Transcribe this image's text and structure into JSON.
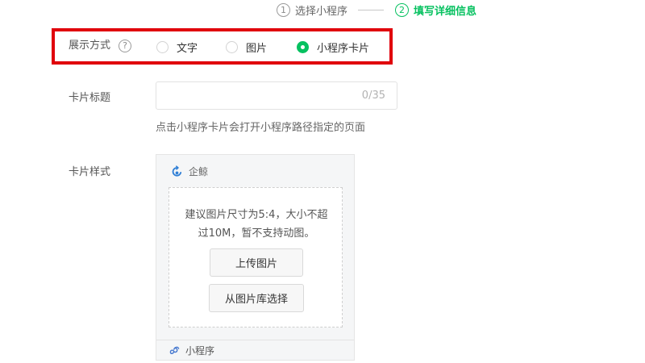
{
  "steps": [
    {
      "num": "1",
      "label": "选择小程序"
    },
    {
      "num": "2",
      "label": "填写详细信息"
    }
  ],
  "display_mode": {
    "label": "展示方式",
    "help": "?",
    "options": [
      "文字",
      "图片",
      "小程序卡片"
    ],
    "selected": "小程序卡片"
  },
  "card_title": {
    "label": "卡片标题",
    "value": "",
    "counter": "0/35",
    "hint": "点击小程序卡片会打开小程序路径指定的页面"
  },
  "card_style": {
    "label": "卡片样式",
    "brand": "企鲸",
    "upload_hint_lines": [
      "建议图片尺寸为5:4，大小不超",
      "过10M，暂不支持动图。"
    ],
    "upload_button": "上传图片",
    "library_button": "从图片库选择",
    "footer": "小程序"
  },
  "colors": {
    "accent": "#07c160",
    "highlight": "#e0000b"
  }
}
